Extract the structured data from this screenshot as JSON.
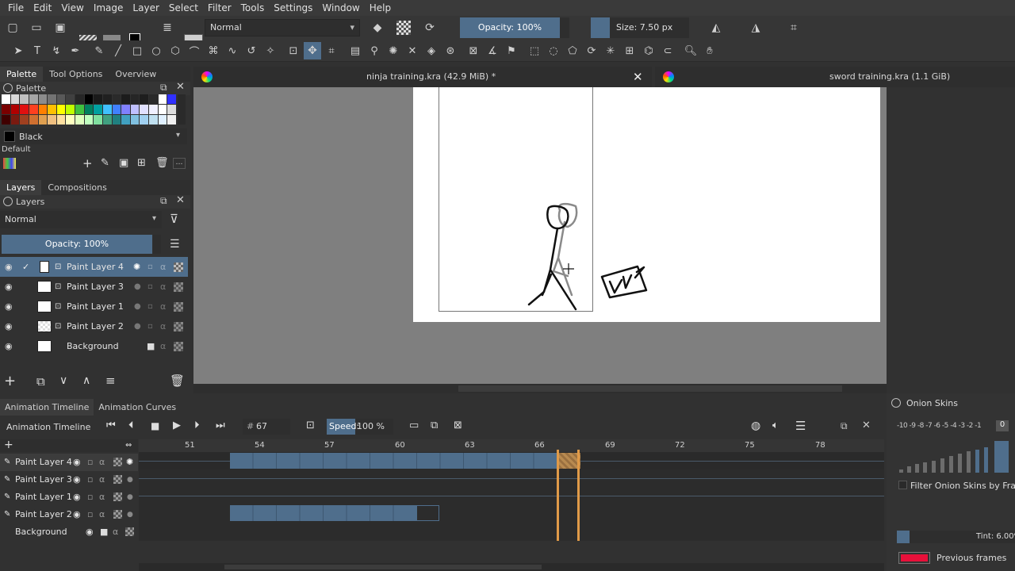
{
  "menu": [
    "File",
    "Edit",
    "View",
    "Image",
    "Layer",
    "Select",
    "Filter",
    "Tools",
    "Settings",
    "Window",
    "Help"
  ],
  "toolbar": {
    "blend_mode": "Normal",
    "opacity": "Opacity: 100%",
    "size": "Size: 7.50 px"
  },
  "left_top_tabs": [
    "Palette",
    "Tool Options",
    "Overview"
  ],
  "palette": {
    "header": "Palette",
    "current_color_name": "Black",
    "set_name": "Default",
    "colors": [
      "#ffffff",
      "#d9d9d9",
      "#bfbfbf",
      "#a6a6a6",
      "#8c8c8c",
      "#737373",
      "#595959",
      "#404040",
      "#262626",
      "#000000",
      "#1a1a1a",
      "#202020",
      "#2a2a2a",
      "#1c1c1c",
      "#262626",
      "#1e1e1e",
      "#2a2a2a",
      "#ffffff",
      "#3030ff",
      "#7a0000",
      "#b00000",
      "#e01010",
      "#ff4020",
      "#ff8000",
      "#ffc000",
      "#ffff00",
      "#c0ff00",
      "#40c040",
      "#008060",
      "#00a0a0",
      "#40c0ff",
      "#4080ff",
      "#8080ff",
      "#c0c0ff",
      "#e0e0ff",
      "#f0f0ff",
      "#ffffff",
      "#dcdcdc",
      "#400000",
      "#7a1a10",
      "#a04020",
      "#d07030",
      "#e0a050",
      "#f0c080",
      "#ffe0a0",
      "#ffffc0",
      "#e0ffc0",
      "#c0ffc0",
      "#80e0a0",
      "#40a080",
      "#208080",
      "#40a0c0",
      "#80c0e0",
      "#a0d0f0",
      "#c0e0f0",
      "#e0f0ff",
      "#f0f0f0"
    ]
  },
  "layers_tabs": [
    "Layers",
    "Compositions"
  ],
  "layers": {
    "header": "Layers",
    "blend_mode": "Normal",
    "opacity": "Opacity:  100%",
    "items": [
      {
        "name": "Paint Layer 4"
      },
      {
        "name": "Paint Layer 3"
      },
      {
        "name": "Paint Layer 1"
      },
      {
        "name": "Paint Layer 2"
      },
      {
        "name": "Background"
      }
    ]
  },
  "documents": [
    {
      "title": "ninja training.kra (42.9 MiB) *"
    },
    {
      "title": "sword training.kra (1.1 GiB)"
    }
  ],
  "timeline": {
    "tabs": [
      "Animation Timeline",
      "Animation Curves"
    ],
    "title": "Animation Timeline",
    "frame_label": "#",
    "frame": "67",
    "speed_label": "Speed:",
    "speed": "100 %",
    "ruler": [
      "51",
      "54",
      "57",
      "60",
      "63",
      "66",
      "69",
      "72",
      "75",
      "78"
    ],
    "rows": [
      "Paint Layer 4",
      "Paint Layer 3",
      "Paint Layer 1",
      "Paint Layer 2",
      "Background"
    ]
  },
  "onion": {
    "header": "Onion Skins",
    "scale": "-10 -9 -8 -7 -6 -5 -4 -3 -2 -1",
    "zero": "0",
    "filter_label": "Filter Onion Skins by Frame",
    "tint": "Tint: 6.00%",
    "previous_label": "Previous frames",
    "previous_color": "#e8103a"
  },
  "colors": {
    "accent": "#4f6e8c",
    "playhead": "#e09a48"
  }
}
